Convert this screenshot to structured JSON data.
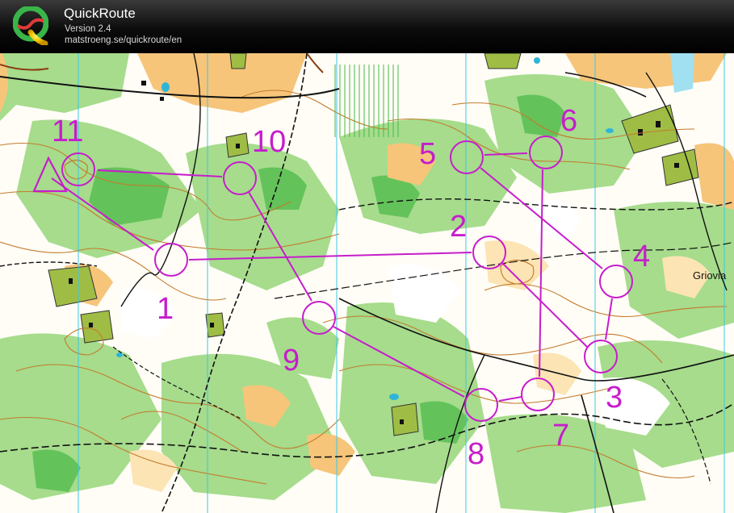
{
  "app": {
    "title": "QuickRoute",
    "version": "Version 2.4",
    "url": "matstroeng.se/quickroute/en"
  },
  "map": {
    "place_name": "Griovia",
    "course_color": "#c61dcc",
    "controls": [
      {
        "label": "1"
      },
      {
        "label": "2"
      },
      {
        "label": "3"
      },
      {
        "label": "4"
      },
      {
        "label": "5"
      },
      {
        "label": "6"
      },
      {
        "label": "7"
      },
      {
        "label": "8"
      },
      {
        "label": "9"
      },
      {
        "label": "10"
      },
      {
        "label": "11"
      }
    ]
  }
}
